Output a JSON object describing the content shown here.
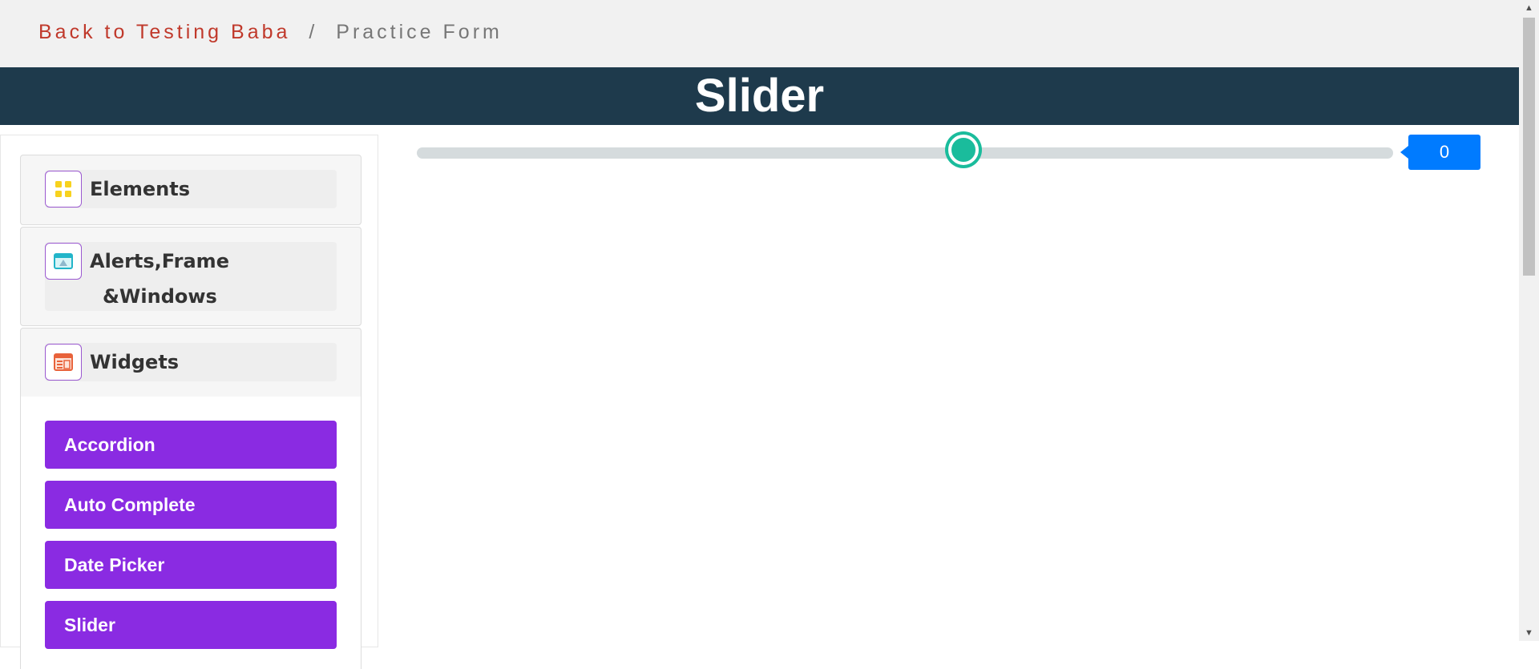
{
  "breadcrumb": {
    "back_label": "Back to Testing Baba",
    "separator": "/",
    "current": "Practice Form"
  },
  "page_title": "Slider",
  "sidebar": {
    "groups": [
      {
        "label": "Elements",
        "icon": "elements-grid-icon"
      },
      {
        "label_line1": "Alerts,Frame",
        "label_line2": "&Windows",
        "icon": "browser-window-icon"
      },
      {
        "label": "Widgets",
        "icon": "widgets-icon"
      }
    ],
    "widget_items": [
      "Accordion",
      "Auto Complete",
      "Date Picker",
      "Slider"
    ]
  },
  "slider": {
    "value": "0",
    "level": 0.56
  },
  "colors": {
    "title_bar": "#1e3a4c",
    "accent_purple": "#8a2be2",
    "slider_thumb": "#1abc9c",
    "value_box": "#007bff",
    "breadcrumb_link": "#c0392b"
  }
}
